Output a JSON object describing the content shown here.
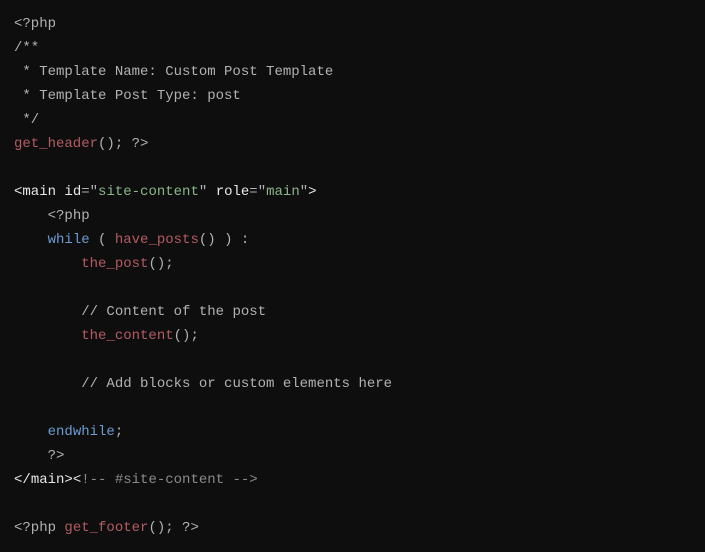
{
  "code": {
    "l1": {
      "open": "<?php"
    },
    "l2": {
      "comment": "/**"
    },
    "l3": {
      "comment": " * Template Name: Custom Post Template"
    },
    "l4": {
      "comment": " * Template Post Type: post"
    },
    "l5": {
      "comment": " */"
    },
    "l6": {
      "fn": "get_header",
      "after": "(); ?>"
    },
    "l7": {
      "blank": ""
    },
    "l8": {
      "a": "<",
      "tag": "main",
      "sp1": " ",
      "attr1": "id",
      "eq1": "=",
      "q1a": "\"",
      "val1": "site-content",
      "q1b": "\"",
      "sp2": " ",
      "attr2": "role",
      "eq2": "=",
      "q2a": "\"",
      "val2": "main",
      "q2b": "\"",
      "close": ">"
    },
    "l9": {
      "pad": "    ",
      "open": "<?php"
    },
    "l10": {
      "pad": "    ",
      "kw": "while",
      "after1": " ( ",
      "fn": "have_posts",
      "after2": "() ) :"
    },
    "l11": {
      "pad": "        ",
      "fn": "the_post",
      "after": "();"
    },
    "l12": {
      "blank": ""
    },
    "l13": {
      "pad": "        ",
      "comment": "// Content of the post"
    },
    "l14": {
      "pad": "        ",
      "fn": "the_content",
      "after": "();"
    },
    "l15": {
      "blank": ""
    },
    "l16": {
      "pad": "        ",
      "comment": "// Add blocks or custom elements here"
    },
    "l17": {
      "blank": ""
    },
    "l18": {
      "pad": "    ",
      "kw": "endwhile",
      "after": ";"
    },
    "l19": {
      "pad": "    ",
      "close": "?>"
    },
    "l20": {
      "a": "</",
      "tag": "main",
      "b": "><",
      "comment": "!-- #site-content -->"
    },
    "l21": {
      "blank": ""
    },
    "l22": {
      "open": "<?php ",
      "fn": "get_footer",
      "after": "(); ?>"
    }
  }
}
